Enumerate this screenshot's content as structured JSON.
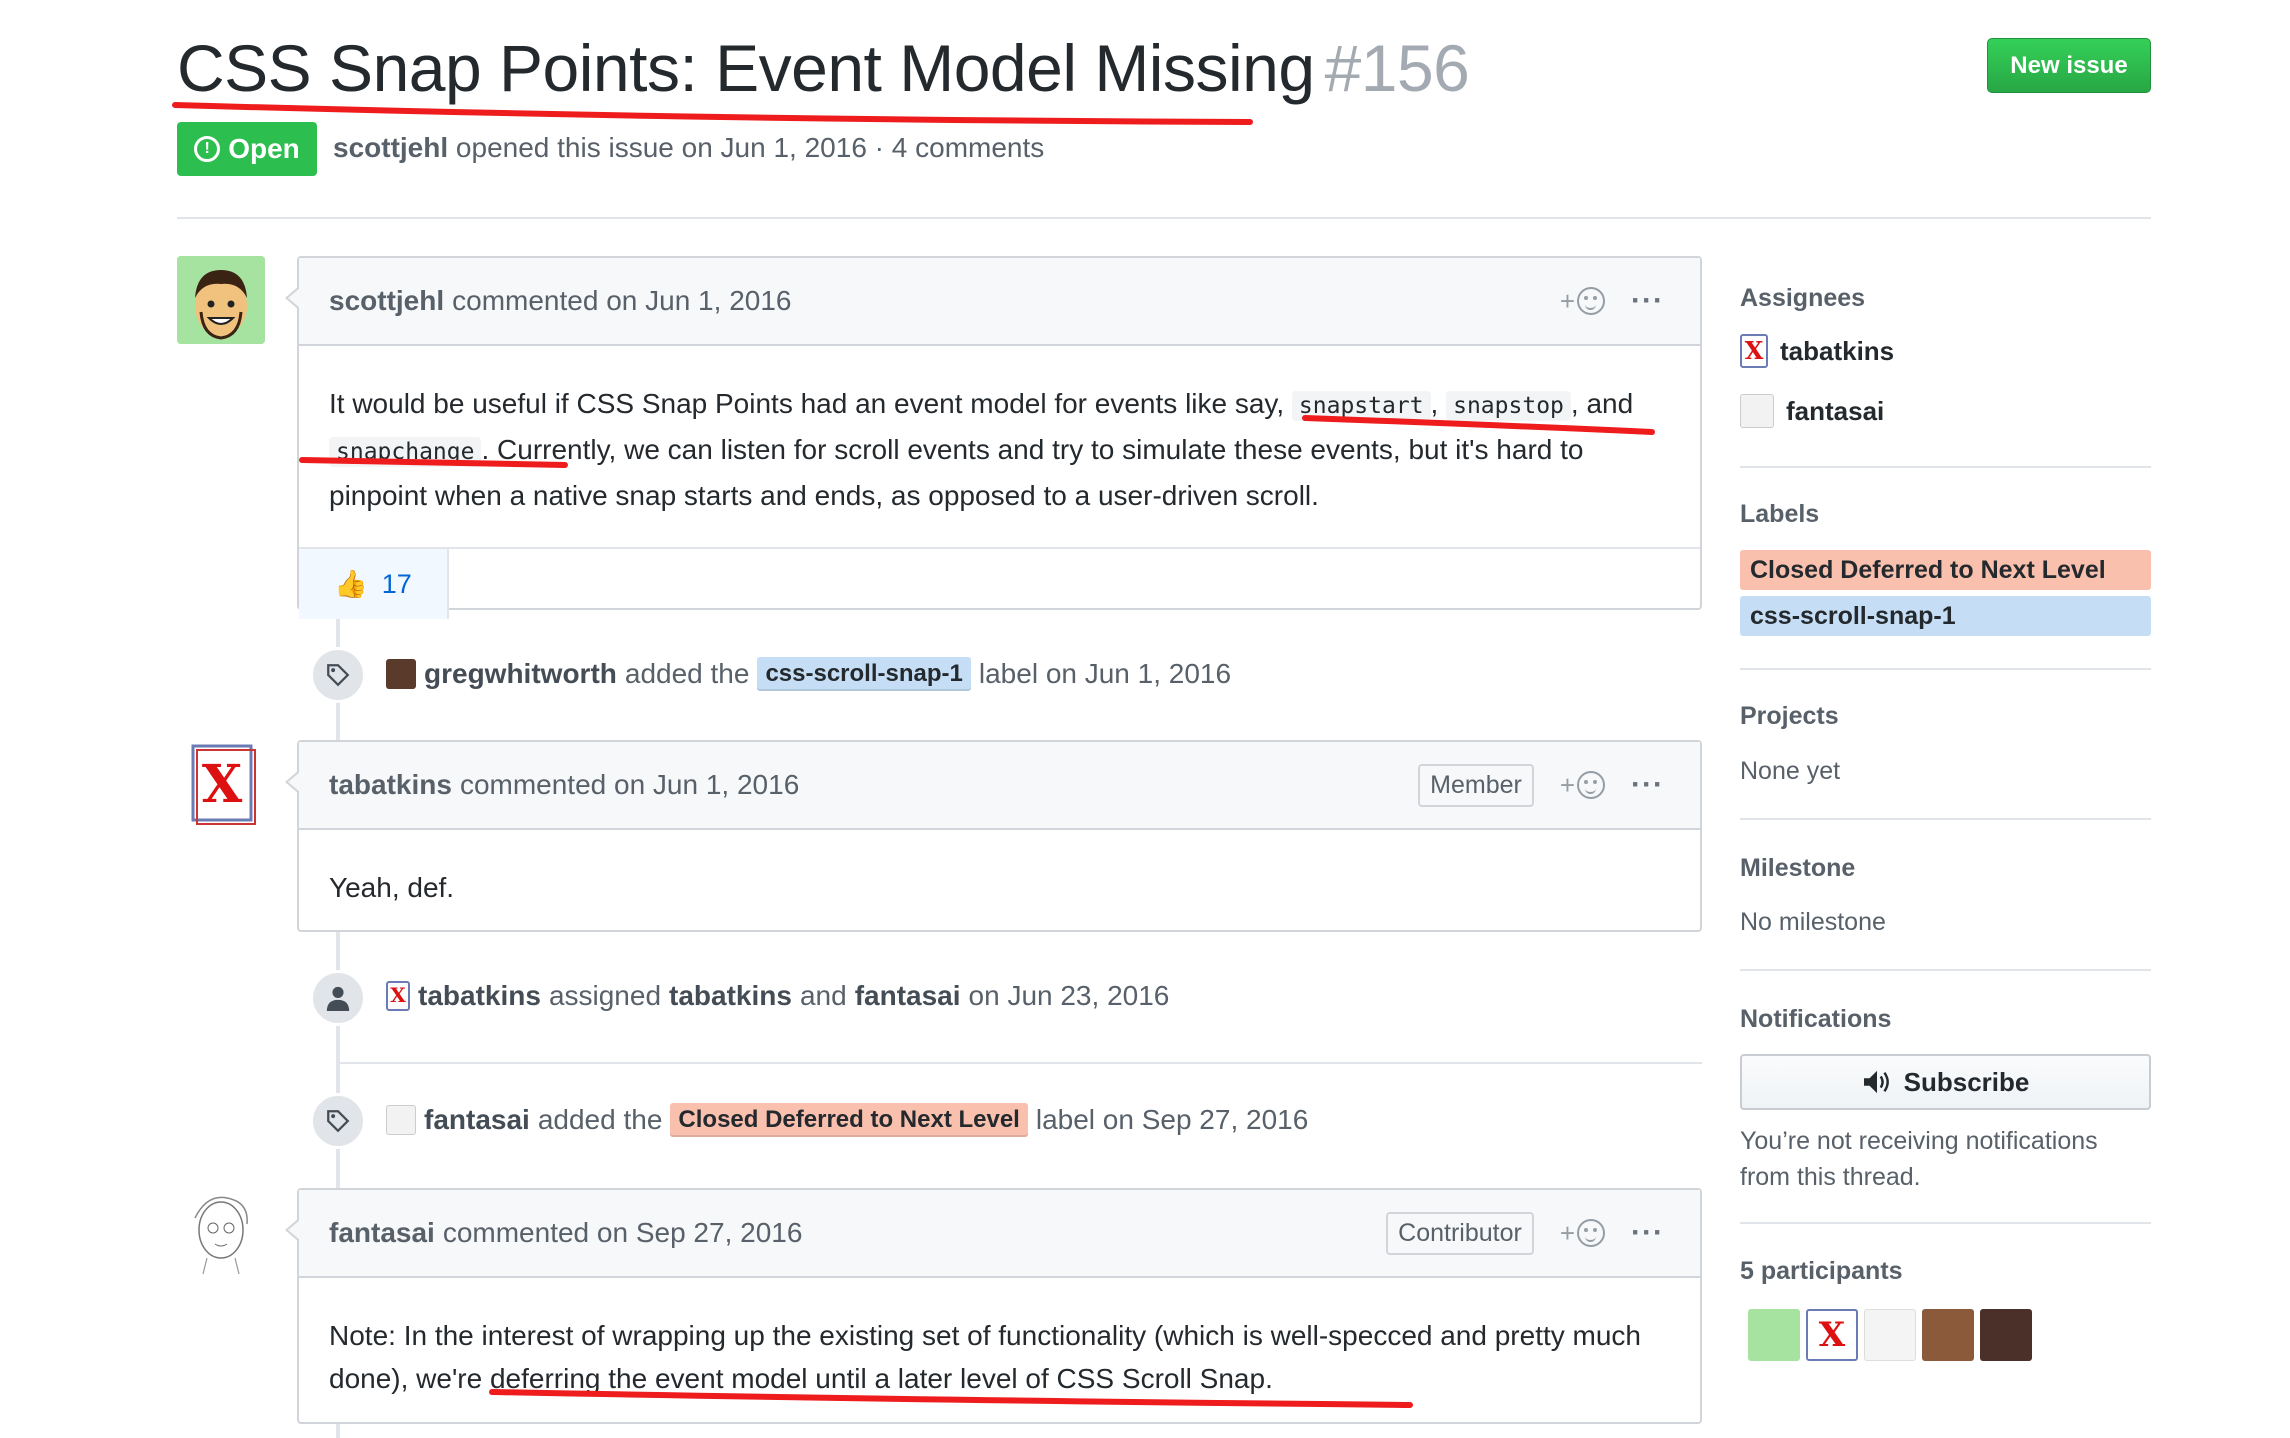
{
  "header": {
    "title": "CSS Snap Points: Event Model Missing",
    "number": "#156",
    "new_issue": "New issue",
    "state": "Open",
    "author": "scottjehl",
    "meta_rest": "opened this issue on Jun 1, 2016 · 4 comments"
  },
  "comments": [
    {
      "author": "scottjehl",
      "when": "commented on Jun 1, 2016",
      "body": {
        "p1": "It would be useful if CSS Snap Points had an event model for events like say,",
        "code1": "snapstart",
        "sep1": ",",
        "code2": "snapstop",
        "sep2": ",",
        "p2": "and",
        "code3": "snapchange",
        "p3": ". Currently, we can listen for scroll events and try to simulate these events, but it's hard to pinpoint when a native snap starts and ends, as opposed to a user-driven scroll."
      },
      "reaction_emoji": "👍",
      "reaction_count": "17"
    },
    {
      "author": "tabatkins",
      "when": "commented on Jun 1, 2016",
      "role": "Member",
      "body": "Yeah, def."
    },
    {
      "author": "fantasai",
      "when": "commented on Sep 27, 2016",
      "role": "Contributor",
      "body": "Note: In the interest of wrapping up the existing set of functionality (which is well-specced and pretty much done), we're deferring the event model until a later level of CSS Scroll Snap."
    }
  ],
  "events": [
    {
      "actor": "gregwhitworth",
      "verb": "added the",
      "label": "css-scroll-snap-1",
      "rest": "label on Jun 1, 2016"
    },
    {
      "actor": "tabatkins",
      "verb": "assigned",
      "target1": "tabatkins",
      "and": "and",
      "target2": "fantasai",
      "rest": "on Jun 23, 2016"
    },
    {
      "actor": "fantasai",
      "verb": "added the",
      "label": "Closed Deferred to Next Level",
      "rest": "label on Sep 27, 2016"
    }
  ],
  "sidebar": {
    "assignees_heading": "Assignees",
    "assignees": [
      "tabatkins",
      "fantasai"
    ],
    "labels_heading": "Labels",
    "labels": [
      "Closed Deferred to Next Level",
      "css-scroll-snap-1"
    ],
    "projects_heading": "Projects",
    "projects_value": "None yet",
    "milestone_heading": "Milestone",
    "milestone_value": "No milestone",
    "notifications_heading": "Notifications",
    "subscribe_label": "Subscribe",
    "notifications_text_1": "You’re not receiving notifications",
    "notifications_text_2": "from this thread.",
    "participants_heading": "5 participants"
  },
  "colors": {
    "green": "#2cbe4e",
    "label_red": "#f9c0ae",
    "label_blue": "#c5def5",
    "annotation_red": "#ee1c1c"
  },
  "icons": {
    "state": "issue-opened-icon",
    "reaction": "smiley-icon",
    "menu": "kebab-horizontal-icon",
    "tag": "tag-icon",
    "person": "person-icon",
    "subscribe": "unmute-icon"
  }
}
